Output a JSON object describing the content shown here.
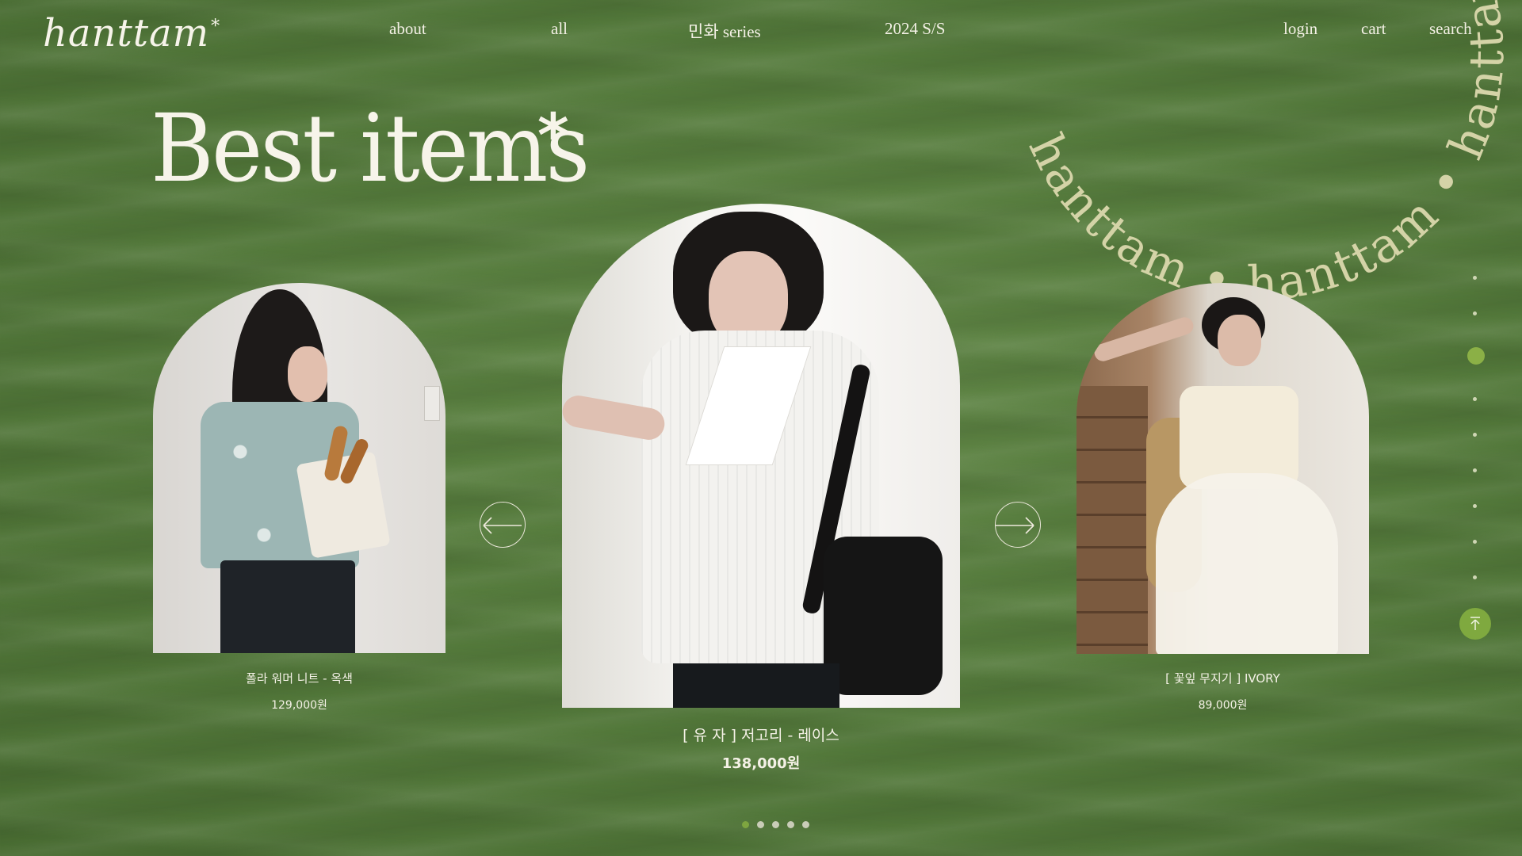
{
  "brand": {
    "logo_text": "hanttam",
    "logo_star": "*"
  },
  "nav": {
    "items": [
      {
        "label": "about"
      },
      {
        "label": "all"
      },
      {
        "label": "민화 series"
      },
      {
        "label": "2024 S/S"
      }
    ]
  },
  "utility": {
    "login": "login",
    "cart": "cart",
    "search": "search"
  },
  "heading": {
    "title": "Best items",
    "star": "*"
  },
  "ring_text": "hanttam  •  hanttam  •  hanttam  •  hanttam  •",
  "products": [
    {
      "name": "폴라 워머 니트 - 옥색",
      "price": "129,000원"
    },
    {
      "name": "[ 유 자 ] 저고리 - 레이스",
      "price": "138,000원"
    },
    {
      "name": "[ 꽃잎 무지기 ] IVORY",
      "price": "89,000원"
    }
  ],
  "icons": {
    "prev": "arrow-left-icon",
    "next": "arrow-right-icon",
    "top": "arrow-up-to-top-icon"
  },
  "pagination": {
    "count": 5,
    "active_index": 0
  },
  "side_nav": {
    "count": 8,
    "active_index": 1
  },
  "colors": {
    "background": "#557b3c",
    "accent": "#7fa93f",
    "text": "#f4f1e6",
    "ring_text": "#d4d3a7"
  }
}
